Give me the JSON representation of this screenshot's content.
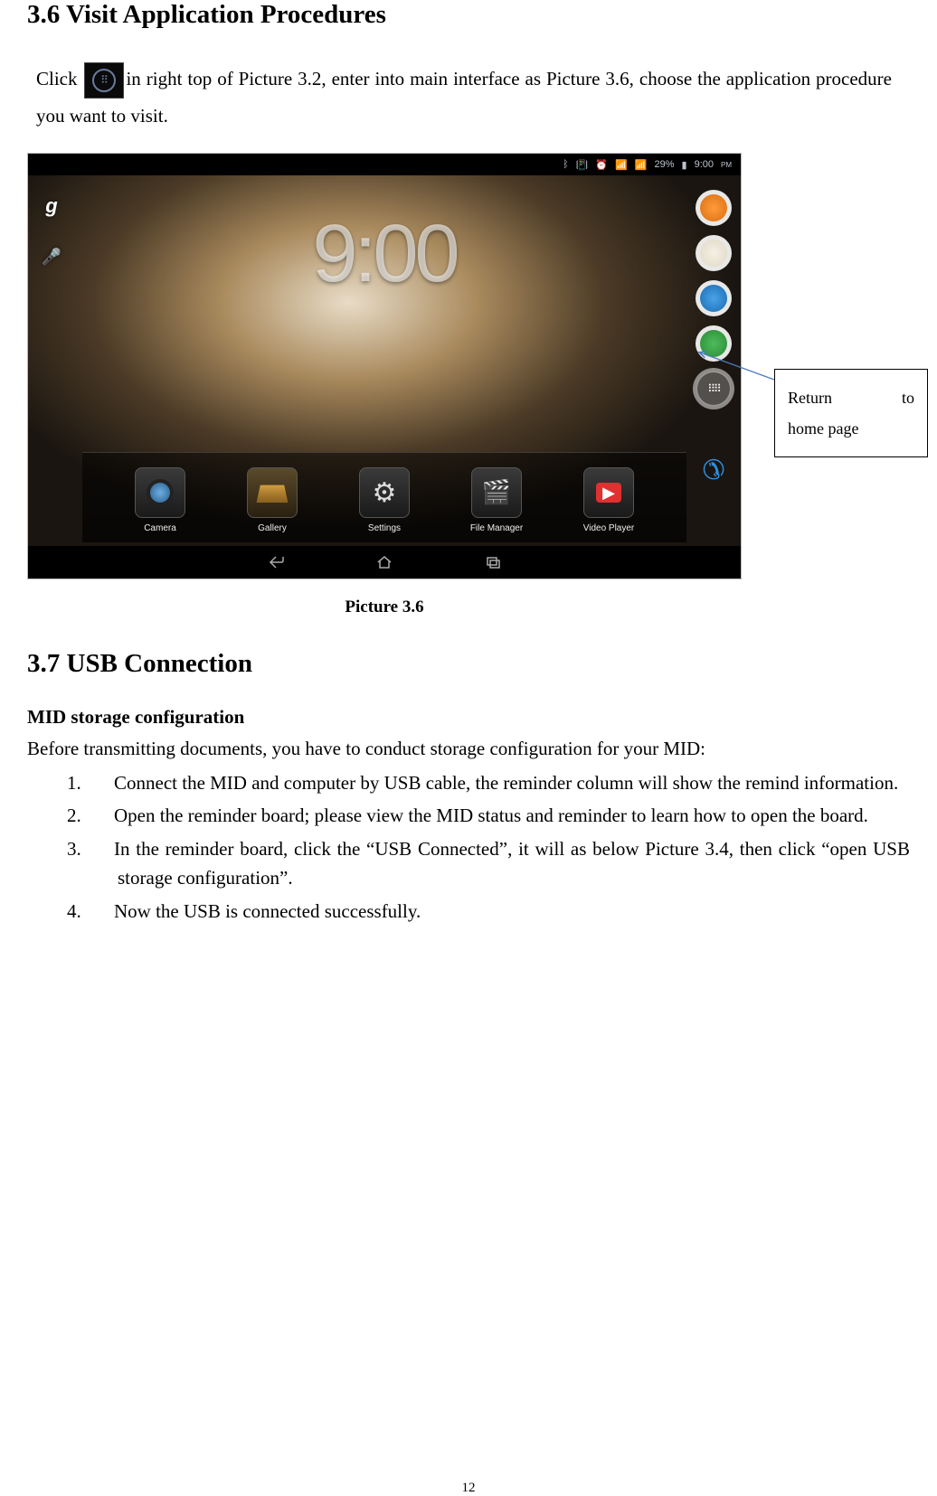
{
  "section1_heading": "3.6 Visit Application Procedures",
  "para1_a": "Click ",
  "para1_b": "in right top of Picture 3.2, enter into main interface as Picture 3.6, choose the application procedure you want to visit.",
  "statusbar": {
    "battery": "29%",
    "time": "9:00"
  },
  "clock_time": "9:00",
  "dock": {
    "camera": "Camera",
    "gallery": "Gallery",
    "settings": "Settings",
    "files": "File Manager",
    "video": "Video Player"
  },
  "caption": "Picture 3.6",
  "callout": {
    "line1": "Return",
    "line2": "to",
    "line3": "home page"
  },
  "section2_heading": "3.7 USB Connection",
  "sub1": "MID storage configuration",
  "sub1_text": "Before transmitting documents, you have to conduct storage configuration for your MID:",
  "steps": {
    "n1": "1.",
    "t1": "Connect the MID and computer by USB cable, the reminder column will show the remind information.",
    "n2": "2.",
    "t2": "Open the reminder board; please view the MID status and reminder to learn how to open the board.",
    "n3": "3.",
    "t3": "In the reminder board, click the “USB Connected”, it will as below Picture 3.4, then click “open USB storage configuration”.",
    "n4": "4.",
    "t4": "Now the USB is connected successfully."
  },
  "page_number": "12"
}
